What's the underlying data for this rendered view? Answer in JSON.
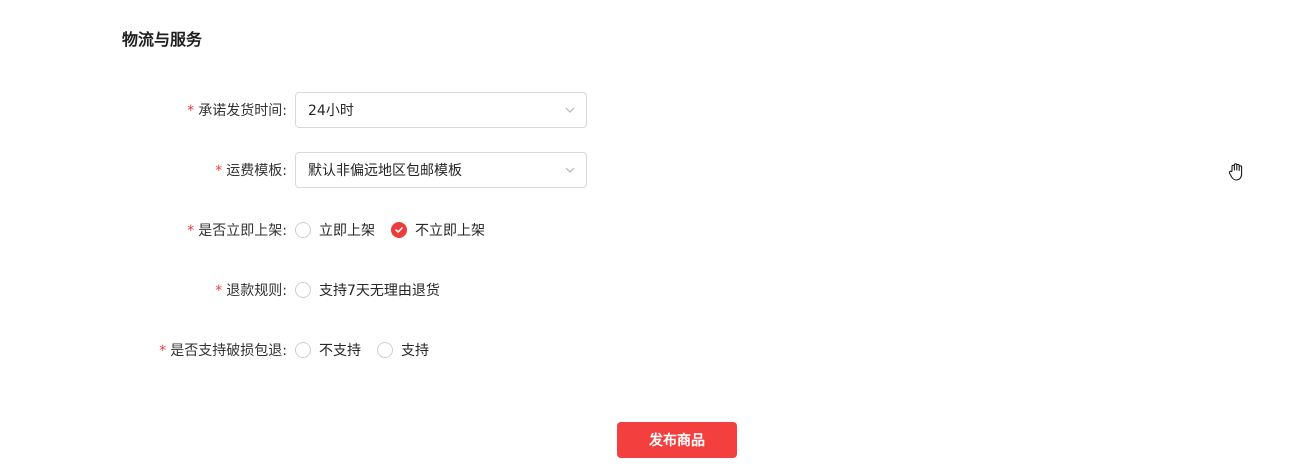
{
  "section": {
    "title": "物流与服务"
  },
  "form": {
    "required_mark": "*",
    "delivery_time": {
      "label": "承诺发货时间:",
      "value": "24小时"
    },
    "shipping_template": {
      "label": "运费模板:",
      "value": "默认非偏远地区包邮模板"
    },
    "list_now": {
      "label": "是否立即上架:",
      "options": [
        {
          "label": "立即上架",
          "checked": false
        },
        {
          "label": "不立即上架",
          "checked": true
        }
      ]
    },
    "refund_rule": {
      "label": "退款规则:",
      "options": [
        {
          "label": "支持7天无理由退货",
          "checked": false
        }
      ]
    },
    "damage_return": {
      "label": "是否支持破损包退:",
      "options": [
        {
          "label": "不支持",
          "checked": false
        },
        {
          "label": "支持",
          "checked": false
        }
      ]
    }
  },
  "actions": {
    "publish_label": "发布商品"
  },
  "colors": {
    "accent": "#f43f3f",
    "required": "#ee3b3b",
    "border": "#d9d9d9"
  },
  "icons": {
    "select_arrow": "chevron-down-icon",
    "radio_checked": "check-icon",
    "cursor": "hand-cursor-icon"
  }
}
